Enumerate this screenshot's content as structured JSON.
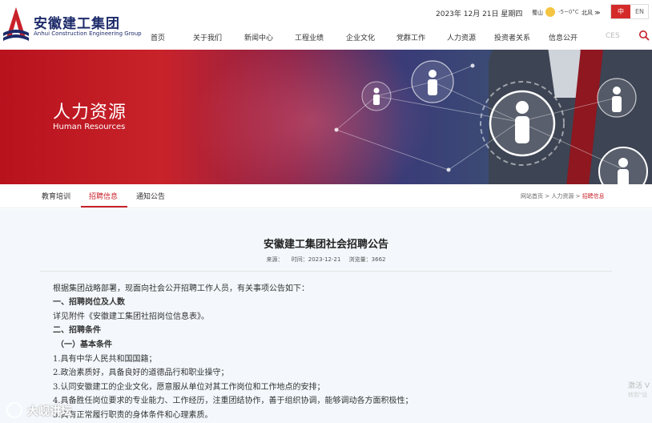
{
  "header": {
    "logo_cn": "安徽建工集团",
    "logo_en": "Anhui Construction Engineering Group",
    "date": "2023年 12月 21日 星期四",
    "weather": {
      "city": "蜀山",
      "temp": "-5~0°C",
      "wind": "北风 ≫"
    },
    "lang": {
      "zh": "中",
      "en": "EN"
    },
    "nav": [
      "首页",
      "关于我们",
      "新闻中心",
      "工程业绩",
      "企业文化",
      "党群工作",
      "人力资源",
      "投资者关系",
      "信息公开"
    ],
    "ces": "CES"
  },
  "banner": {
    "title": "人力资源",
    "subtitle": "Human Resources"
  },
  "subnav": {
    "tabs": [
      "教育培训",
      "招聘信息",
      "通知公告"
    ],
    "active": "招聘信息",
    "breadcrumb": {
      "home": "网站首页",
      "sep": ">",
      "section": "人力资源",
      "current": "招聘信息"
    }
  },
  "article": {
    "title": "安徽建工集团社会招聘公告",
    "source": "来源：",
    "time": "时间：2023-12-21",
    "views": "浏览量：3662",
    "lines": [
      "根据集团战略部署，现面向社会公开招聘工作人员，有关事项公告如下：",
      "一、招聘岗位及人数",
      "详见附件《安徽建工集团社招岗位信息表》。",
      "二、招聘条件",
      "（一）基本条件",
      "1.具有中华人民共和国国籍；",
      "2.政治素质好，具备良好的道德品行和职业操守；",
      "3.认同安徽建工的企业文化，愿意服从单位对其工作岗位和工作地点的安排；",
      "4.具备胜任岗位要求的专业能力、工作经历，注重团结协作，善于组织协调，能够调动各方面积极性；",
      "5.具有正常履行职责的身体条件和心理素质。"
    ]
  },
  "watermarks": {
    "activate": "激活 V",
    "activate_sub": "转到\"设",
    "brand": "大岘讲坛"
  },
  "colors": {
    "brand_red": "#c8222a",
    "navy": "#1d2b6a"
  }
}
